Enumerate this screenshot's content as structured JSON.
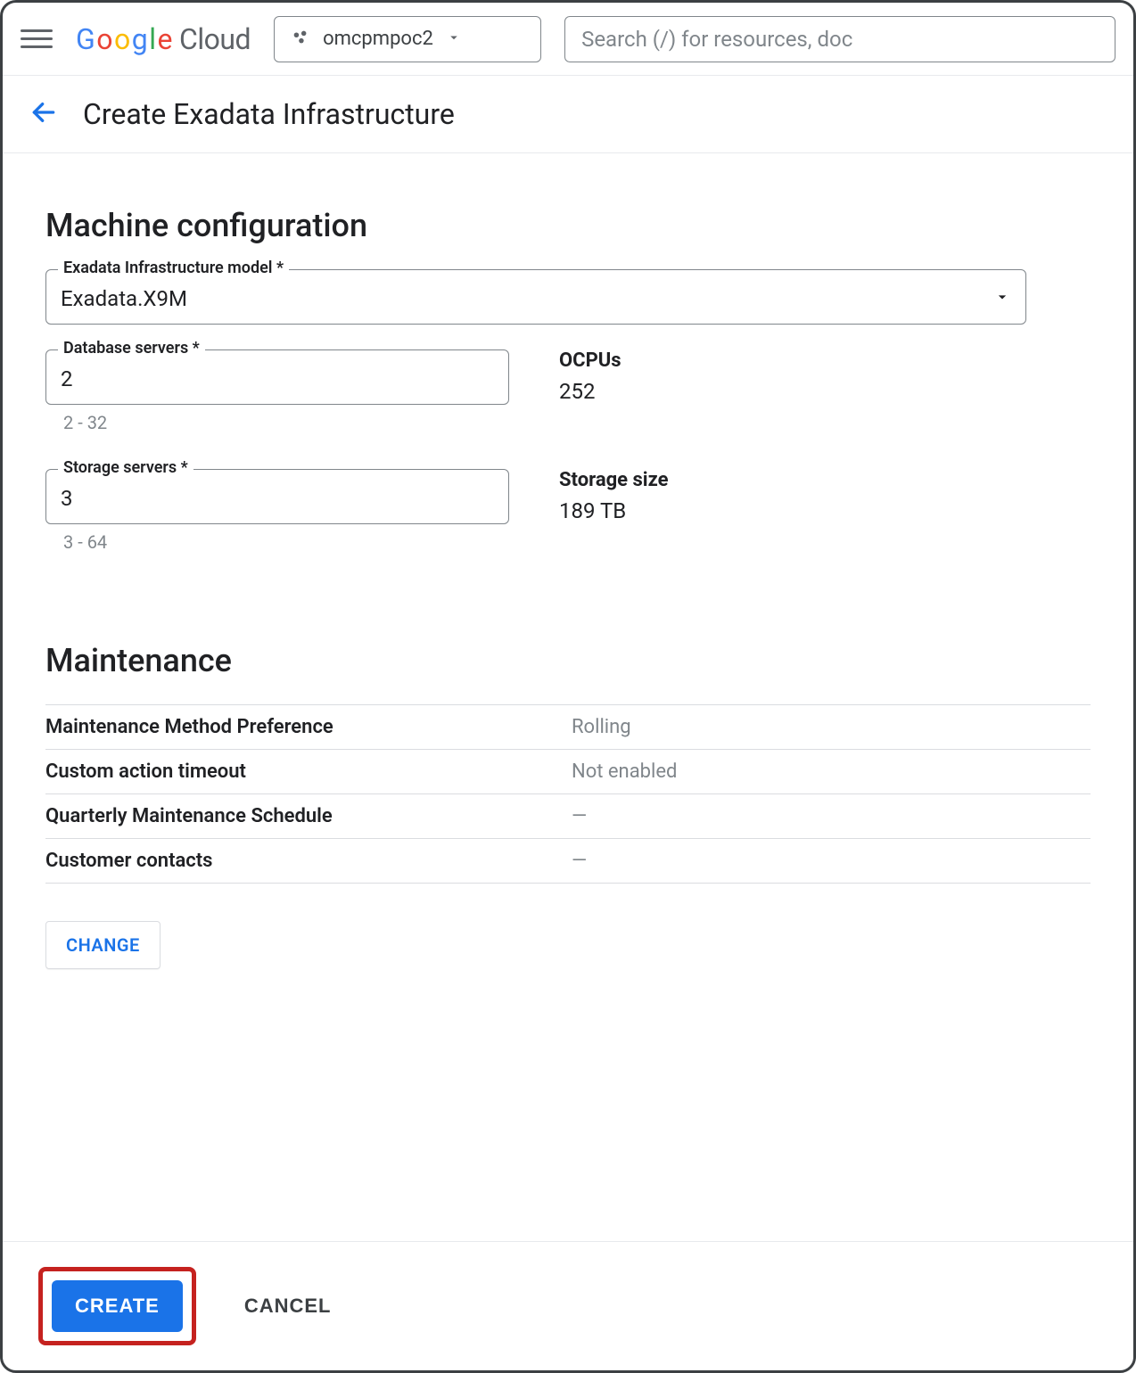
{
  "header": {
    "brand_google": "Google",
    "brand_cloud": "Cloud",
    "project_name": "omcpmpoc2",
    "search_placeholder": "Search (/) for resources, doc"
  },
  "page": {
    "title": "Create Exadata Infrastructure"
  },
  "machine_config": {
    "section_title": "Machine configuration",
    "model_label": "Exadata Infrastructure model *",
    "model_value": "Exadata.X9M",
    "db_servers_label": "Database servers *",
    "db_servers_value": "2",
    "db_servers_hint": "2 - 32",
    "ocpus_label": "OCPUs",
    "ocpus_value": "252",
    "storage_servers_label": "Storage servers *",
    "storage_servers_value": "3",
    "storage_servers_hint": "3 - 64",
    "storage_size_label": "Storage size",
    "storage_size_value": "189 TB"
  },
  "maintenance": {
    "section_title": "Maintenance",
    "rows": [
      {
        "k": "Maintenance Method Preference",
        "v": "Rolling"
      },
      {
        "k": "Custom action timeout",
        "v": "Not enabled"
      },
      {
        "k": "Quarterly Maintenance Schedule",
        "v": "—"
      },
      {
        "k": "Customer contacts",
        "v": "—"
      }
    ],
    "change_label": "CHANGE"
  },
  "actions": {
    "create_label": "CREATE",
    "cancel_label": "CANCEL"
  }
}
